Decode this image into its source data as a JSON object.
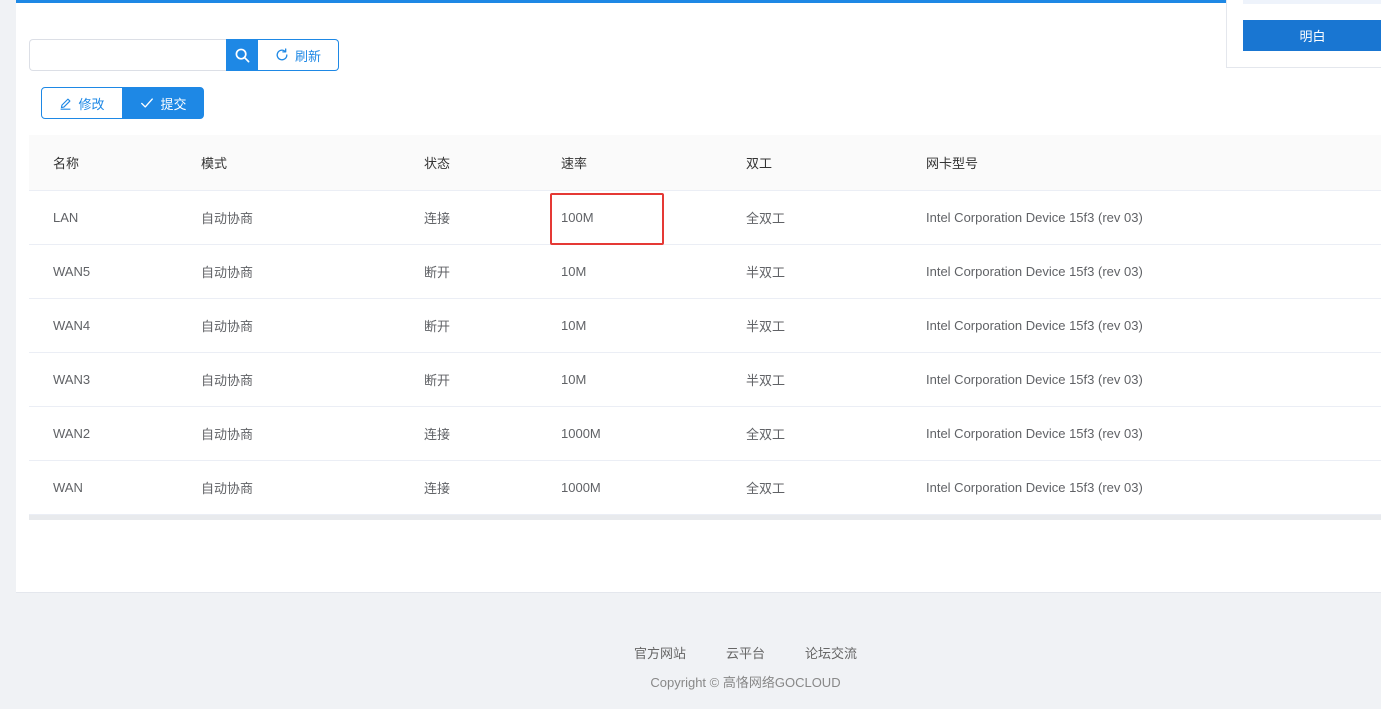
{
  "toolbar": {
    "search_value": "",
    "refresh_label": "刷新",
    "edit_label": "修改",
    "submit_label": "提交"
  },
  "table": {
    "headers": [
      "名称",
      "模式",
      "状态",
      "速率",
      "双工",
      "网卡型号"
    ],
    "rows": [
      [
        "LAN",
        "自动协商",
        "连接",
        "100M",
        "全双工",
        "Intel Corporation Device 15f3 (rev 03)"
      ],
      [
        "WAN5",
        "自动协商",
        "断开",
        "10M",
        "半双工",
        "Intel Corporation Device 15f3 (rev 03)"
      ],
      [
        "WAN4",
        "自动协商",
        "断开",
        "10M",
        "半双工",
        "Intel Corporation Device 15f3 (rev 03)"
      ],
      [
        "WAN3",
        "自动协商",
        "断开",
        "10M",
        "半双工",
        "Intel Corporation Device 15f3 (rev 03)"
      ],
      [
        "WAN2",
        "自动协商",
        "连接",
        "1000M",
        "全双工",
        "Intel Corporation Device 15f3 (rev 03)"
      ],
      [
        "WAN",
        "自动协商",
        "连接",
        "1000M",
        "全双工",
        "Intel Corporation Device 15f3 (rev 03)"
      ]
    ]
  },
  "popup": {
    "ok_label": "明白"
  },
  "footer": {
    "links": [
      "官方网站",
      "云平台",
      "论坛交流"
    ],
    "copyright": "Copyright © 高恪网络GOCLOUD"
  },
  "colors": {
    "accent": "#1e88e5",
    "highlight": "#e53935"
  },
  "icons": {
    "search": "search-icon",
    "refresh": "refresh-icon",
    "edit": "edit-icon",
    "submit": "check-icon"
  }
}
